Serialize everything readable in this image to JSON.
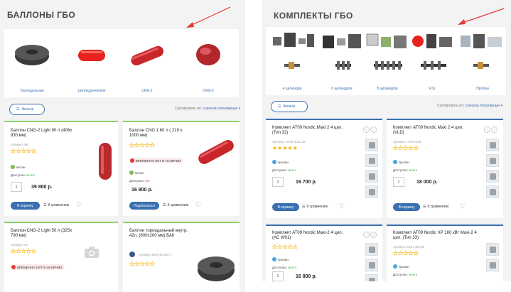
{
  "left": {
    "title": "БАЛЛОНЫ ГБО",
    "categories": [
      "Тороидальные",
      "Цилиндрические",
      "CNG-1",
      "CNG-2"
    ],
    "filter_label": "Фильтр",
    "sort_label": "Сортировать по:",
    "sort_value": "сначала популярные",
    "products": [
      {
        "title": "Баллон CNG-2 Light 90 л (406х 930 мм)",
        "article": "Артикул: 96",
        "tag": "метан",
        "available_label": "Доступно:",
        "available_value": "много",
        "qty": "1",
        "price": "39 800 р.",
        "cart": "В корзину",
        "compare": "К сравнению"
      },
      {
        "title": "Баллон CNG 1 60 л ( 219 х 1000 мм)",
        "badge": "ВРЕМЕННО НЕТ В НАЛИЧИИ",
        "tag": "метан",
        "available_label": "Доступно:",
        "available_value": "нет",
        "price": "16 800 р.",
        "cart": "Подписаться",
        "compare": "К сравнению"
      },
      {
        "title": "Баллон CNG-2 Light 50 л (325х 790 мм)",
        "article": "Артикул: 97",
        "badge": "ВРЕМЕННО НЕТ В НАЛИЧИИ"
      },
      {
        "title": "Баллон тороидальный внутр. 42л. (600х200 мм) БАК",
        "article": "Артикул: БАК 42.600.Т"
      }
    ]
  },
  "right": {
    "title": "КОМПЛЕКТЫ ГБО",
    "categories": [
      "4 цилиндра",
      "6 цилиндров",
      "8 цилиндров",
      "FSI",
      "Пропан"
    ],
    "filter_label": "Фильтр",
    "sort_label": "Сортировать по:",
    "sort_value": "сначала популярные",
    "products": [
      {
        "title": "Комплект AT09 Nordic Maxi 2 4 цил. (Тип 32)",
        "article": "Артикул: AT09 4CIL 32",
        "tag": "пропан",
        "available_label": "Доступно:",
        "available_value": "много",
        "qty": "1",
        "price": "16 700 р.",
        "cart": "В корзину",
        "compare": "К сравнению"
      },
      {
        "title": "Комплект AT09 Nordic Maxi 2 4 цил. (VLD)",
        "article": "Артикул: AT09 4CIL",
        "tag": "пропан",
        "available_label": "Доступно:",
        "available_value": "много",
        "qty": "1",
        "price": "18 000 р.",
        "cart": "В корзину",
        "compare": "К сравнению"
      },
      {
        "title": "Комплект AT09 Nordic Maxi-2 4 цил. (AC W01)",
        "tag": "пропан",
        "available_label": "Доступно:",
        "available_value": "много",
        "qty": "1",
        "price": "16 800 р."
      },
      {
        "title": "Комплект AT09 Nordic XP 180 кВт Maxi-2 4 цил. (Тип 33)",
        "article": "Артикул: E13-A36-33",
        "tag": "пропан",
        "available_label": "Доступно:",
        "available_value": "много"
      }
    ]
  },
  "colors": {
    "accent": "#3a6fb0",
    "green_border": "#8ad36a",
    "arrow": "#e53935",
    "star": "#f5b301"
  }
}
